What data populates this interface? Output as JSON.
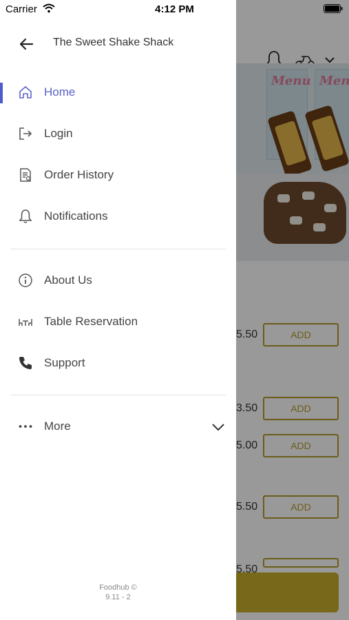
{
  "status_bar": {
    "carrier": "Carrier",
    "time": "4:12 PM"
  },
  "drawer": {
    "restaurant_name": "The Sweet Shake Shack",
    "primary_items": [
      {
        "label": "Home",
        "icon": "home-icon",
        "active": true
      },
      {
        "label": "Login",
        "icon": "login-icon",
        "active": false
      },
      {
        "label": "Order History",
        "icon": "receipt-icon",
        "active": false
      },
      {
        "label": "Notifications",
        "icon": "bell-icon",
        "active": false
      }
    ],
    "secondary_items": [
      {
        "label": "About Us",
        "icon": "info-icon"
      },
      {
        "label": "Table Reservation",
        "icon": "table-icon"
      },
      {
        "label": "Support",
        "icon": "phone-icon"
      }
    ],
    "more_label": "More",
    "footer": {
      "line1": "Foodhub ©",
      "line2": "9.11 - 2"
    }
  },
  "background": {
    "banner_text": "Menu",
    "prices": [
      "5.50",
      "3.50",
      "5.00",
      "5.50",
      "5.50"
    ],
    "add_label": "ADD"
  },
  "colors": {
    "accent": "#5b63c9",
    "add_button": "#b39a2a",
    "bottom_bar": "#c9ad2c"
  }
}
